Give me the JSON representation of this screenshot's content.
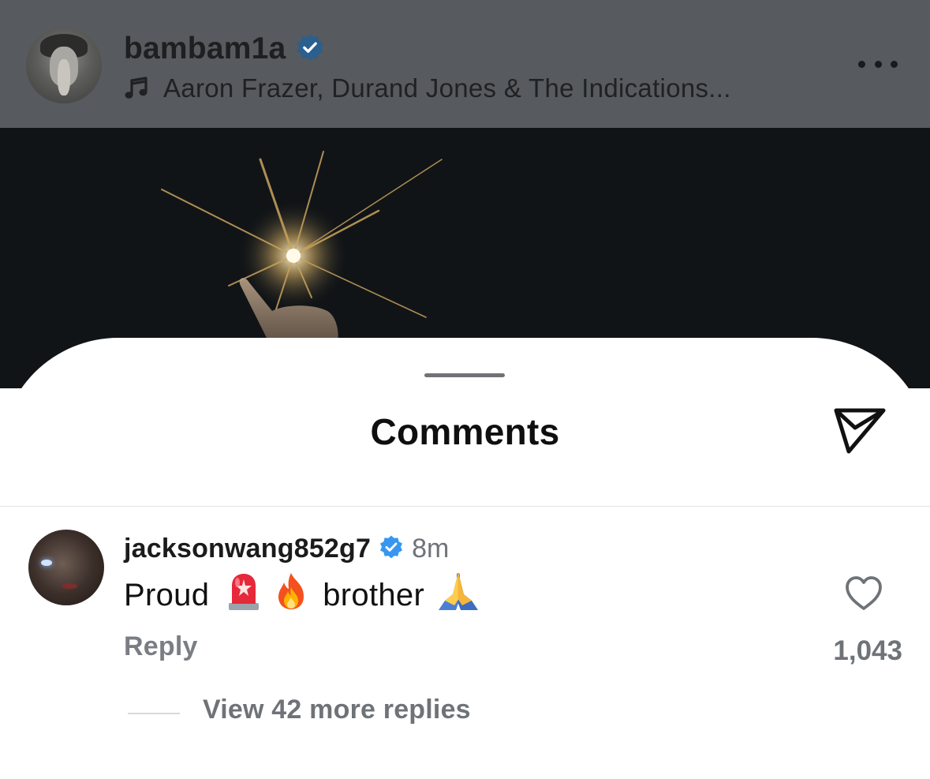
{
  "post": {
    "username": "bambam1a",
    "music": "Aaron Frazer, Durand Jones & The Indications...",
    "verified": true
  },
  "sheet": {
    "title": "Comments"
  },
  "comment": {
    "username": "jacksonwang852g7",
    "time": "8m",
    "text_parts": {
      "proud": "Proud",
      "brother": "brother"
    },
    "emojis": [
      "siren-emoji",
      "fire-emoji",
      "folded-hands-emoji"
    ],
    "reply_label": "Reply",
    "like_count": "1,043",
    "view_replies": "View 42 more replies"
  },
  "colors": {
    "header_bg": "#575a5e",
    "media_bg": "#111417",
    "verified_blue": "#3797f0",
    "muted_text": "#6f7378"
  },
  "icons": {
    "music": "music-note-icon",
    "more": "more-horizontal-icon",
    "share": "send-icon",
    "like": "heart-outline-icon",
    "verified": "verified-badge-icon"
  }
}
